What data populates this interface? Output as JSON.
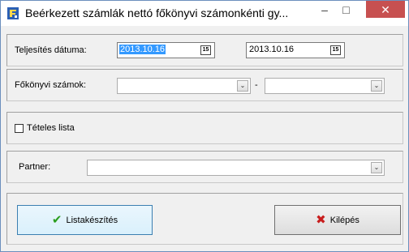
{
  "window": {
    "title": "Beérkezett számlák nettó főkönyvi számonkénti gy...",
    "minimize_glyph": "–",
    "maximize_glyph": "□",
    "close_glyph": "✕"
  },
  "performance_date": {
    "label": "Teljesítés dátuma:",
    "from_value": "2013.10.16",
    "to_value": "2013.10.16",
    "calendar_icon_text": "15"
  },
  "ledger_accounts": {
    "label": "Főkönyvi számok:",
    "from_value": "",
    "to_value": "",
    "separator": "-",
    "dropdown_glyph": "⌄"
  },
  "itemized_list": {
    "label": "Tételes lista",
    "checked": false
  },
  "partner": {
    "label": "Partner:",
    "value": "",
    "dropdown_glyph": "⌄"
  },
  "buttons": {
    "generate_label": "Listakészítés",
    "exit_label": "Kilépés",
    "check_glyph": "✔",
    "x_glyph": "✖"
  },
  "colors": {
    "selection": "#3399ff",
    "close_button": "#c75050",
    "check_icon": "#2a9d1e",
    "x_icon": "#c81e1e"
  }
}
